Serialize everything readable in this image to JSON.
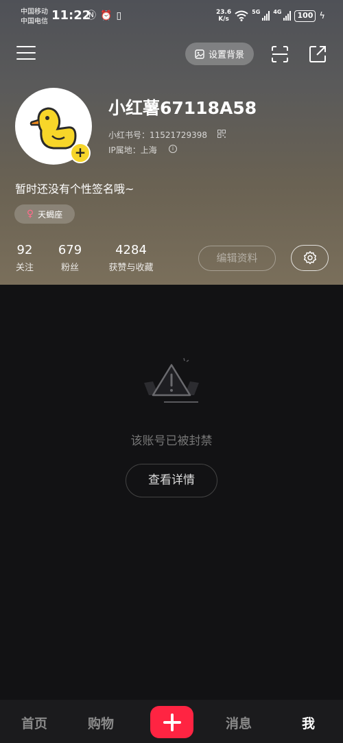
{
  "status_bar": {
    "carrier1": "中国移动",
    "carrier2": "中国电信",
    "time": "11:22",
    "speed_value": "23.6",
    "speed_unit": "K/s",
    "net1": "5G",
    "net2": "4G",
    "battery": "100"
  },
  "top_nav": {
    "set_background_label": "设置背景"
  },
  "profile": {
    "nickname": "小红薯67118A58",
    "xhs_id": "小红书号：11521729398",
    "ip_location": "IP属地：上海",
    "bio": "暂时还没有个性签名哦~",
    "zodiac": "天蝎座"
  },
  "stats": [
    {
      "value": "92",
      "label": "关注"
    },
    {
      "value": "679",
      "label": "粉丝"
    },
    {
      "value": "4284",
      "label": "获赞与收藏"
    }
  ],
  "actions": {
    "edit_profile": "编辑资料"
  },
  "content": {
    "banned_message": "该账号已被封禁",
    "view_details": "查看详情"
  },
  "tabbar": {
    "home": "首页",
    "shop": "购物",
    "messages": "消息",
    "me": "我",
    "active": "me"
  },
  "colors": {
    "accent": "#ff2442",
    "avatar_badge": "#f6d52a",
    "background": "#121214"
  }
}
